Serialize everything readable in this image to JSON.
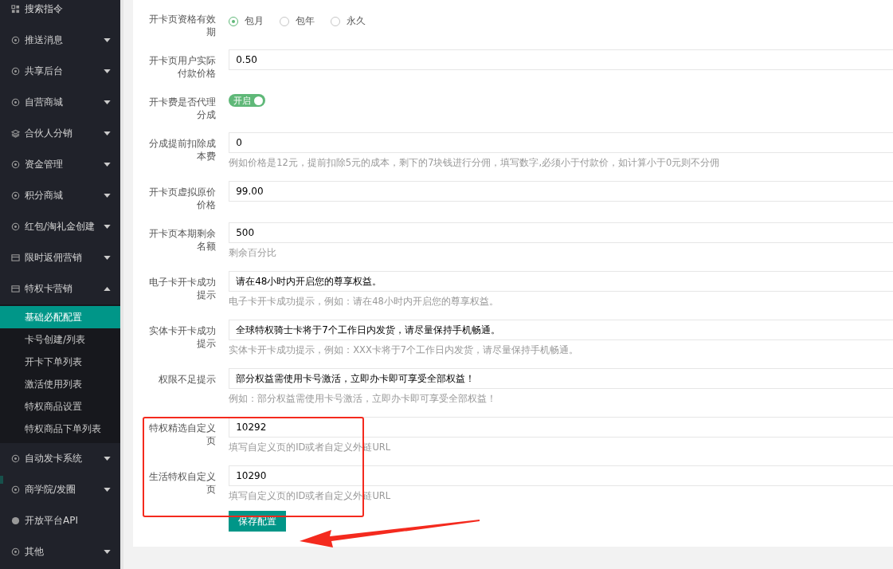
{
  "sidebar": {
    "items": [
      {
        "label": "搜索指令",
        "expandable": false,
        "expanded": false
      },
      {
        "label": "推送消息",
        "expandable": true,
        "expanded": false
      },
      {
        "label": "共享后台",
        "expandable": true,
        "expanded": false
      },
      {
        "label": "自营商城",
        "expandable": true,
        "expanded": false
      },
      {
        "label": "合伙人分销",
        "expandable": true,
        "expanded": false
      },
      {
        "label": "资金管理",
        "expandable": true,
        "expanded": false
      },
      {
        "label": "积分商城",
        "expandable": true,
        "expanded": false
      },
      {
        "label": "红包/淘礼金创建",
        "expandable": true,
        "expanded": false
      },
      {
        "label": "限时返佣营销",
        "expandable": true,
        "expanded": false
      },
      {
        "label": "特权卡营销",
        "expandable": true,
        "expanded": true,
        "children": [
          {
            "label": "基础必配配置",
            "selected": true
          },
          {
            "label": "卡号创建/列表",
            "selected": false
          },
          {
            "label": "开卡下单列表",
            "selected": false
          },
          {
            "label": "激活使用列表",
            "selected": false
          },
          {
            "label": "特权商品设置",
            "selected": false
          },
          {
            "label": "特权商品下单列表",
            "selected": false
          }
        ]
      },
      {
        "label": "自动发卡系统",
        "expandable": true,
        "expanded": false
      },
      {
        "label": "商学院/发圈",
        "expandable": true,
        "expanded": false
      },
      {
        "label": "开放平台API",
        "expandable": false,
        "expanded": false
      },
      {
        "label": "其他",
        "expandable": true,
        "expanded": false
      }
    ]
  },
  "form": {
    "fields": [
      {
        "kind": "radio",
        "label": "开卡页资格有效期",
        "options": [
          {
            "label": "包月",
            "selected": true
          },
          {
            "label": "包年",
            "selected": false
          },
          {
            "label": "永久",
            "selected": false
          }
        ]
      },
      {
        "kind": "input",
        "label": "开卡页用户实际付款价格",
        "value": "0.50"
      },
      {
        "kind": "toggle",
        "label": "开卡费是否代理分成",
        "on": true,
        "text": "开启"
      },
      {
        "kind": "input",
        "label": "分成提前扣除成本费",
        "value": "0",
        "hint": "例如价格是12元，提前扣除5元的成本，剩下的7块钱进行分佣，填写数字,必须小于付款价，如计算小于0元则不分佣"
      },
      {
        "kind": "input",
        "label": "开卡页虚拟原价价格",
        "value": "99.00"
      },
      {
        "kind": "input",
        "label": "开卡页本期剩余名额",
        "value": "500",
        "hint": "剩余百分比"
      },
      {
        "kind": "input",
        "label": "电子卡开卡成功提示",
        "value": "请在48小时内开启您的尊享权益。",
        "hint": "电子卡开卡成功提示，例如：请在48小时内开启您的尊享权益。"
      },
      {
        "kind": "input",
        "label": "实体卡开卡成功提示",
        "value": "全球特权骑士卡将于7个工作日内发货，请尽量保持手机畅通。",
        "hint": "实体卡开卡成功提示，例如：XXX卡将于7个工作日内发货，请尽量保持手机畅通。"
      },
      {
        "kind": "input",
        "label": "权限不足提示",
        "value": "部分权益需使用卡号激活，立即办卡即可享受全部权益！",
        "hint": "例如：部分权益需使用卡号激活，立即办卡即可享受全部权益！"
      },
      {
        "kind": "input",
        "label": "特权精选自定义页",
        "value": "10292",
        "hint": "填写自定义页的ID或者自定义外链URL"
      },
      {
        "kind": "input",
        "label": "生活特权自定义页",
        "value": "10290",
        "hint": "填写自定义页的ID或者自定义外链URL"
      }
    ],
    "save_button": "保存配置"
  }
}
